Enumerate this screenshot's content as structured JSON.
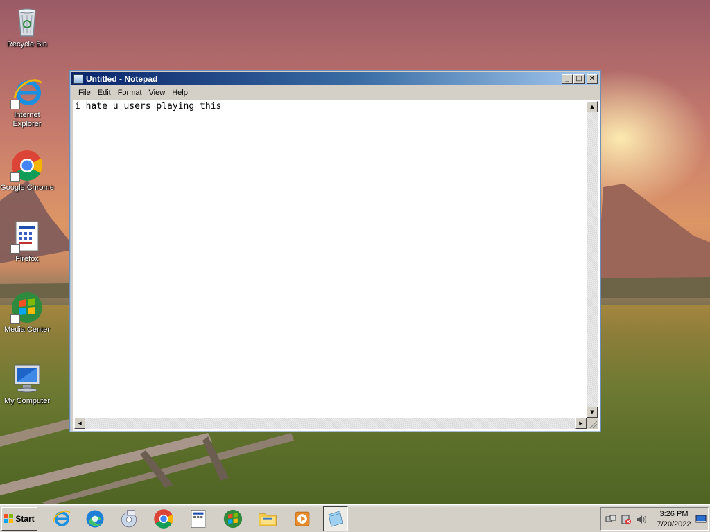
{
  "desktop": {
    "icons": [
      {
        "label": "Recycle Bin",
        "icon": "recycle-bin-icon"
      },
      {
        "label": "Internet Explorer",
        "icon": "internet-explorer-icon"
      },
      {
        "label": "Google Chrome",
        "icon": "chrome-icon"
      },
      {
        "label": "Firefox",
        "icon": "firefox-icon"
      },
      {
        "label": "Media Center",
        "icon": "media-center-icon"
      },
      {
        "label": "My Computer",
        "icon": "my-computer-icon"
      }
    ]
  },
  "window": {
    "title": "Untitled - Notepad",
    "controls": {
      "minimize": "_",
      "maximize": "□",
      "close": "✕"
    },
    "menu": [
      "File",
      "Edit",
      "Format",
      "View",
      "Help"
    ],
    "content": "i hate u users playing this",
    "scroll_up": "▲",
    "scroll_down": "▼",
    "scroll_left": "◀",
    "scroll_right": "▶"
  },
  "taskbar": {
    "start_label": "Start",
    "pinned": [
      "internet-explorer-icon",
      "edge-icon",
      "media-player-icon",
      "chrome-icon",
      "notepad-file-icon",
      "windows-media-center-icon",
      "file-explorer-icon",
      "media-player-play-icon",
      "notepad-icon"
    ],
    "clock": {
      "time": "3:26 PM",
      "date": "7/20/2022"
    }
  },
  "colors": {
    "titlebar_start": "#0a246a",
    "titlebar_end": "#a6caf0",
    "chrome_face": "#d4d0c8"
  }
}
